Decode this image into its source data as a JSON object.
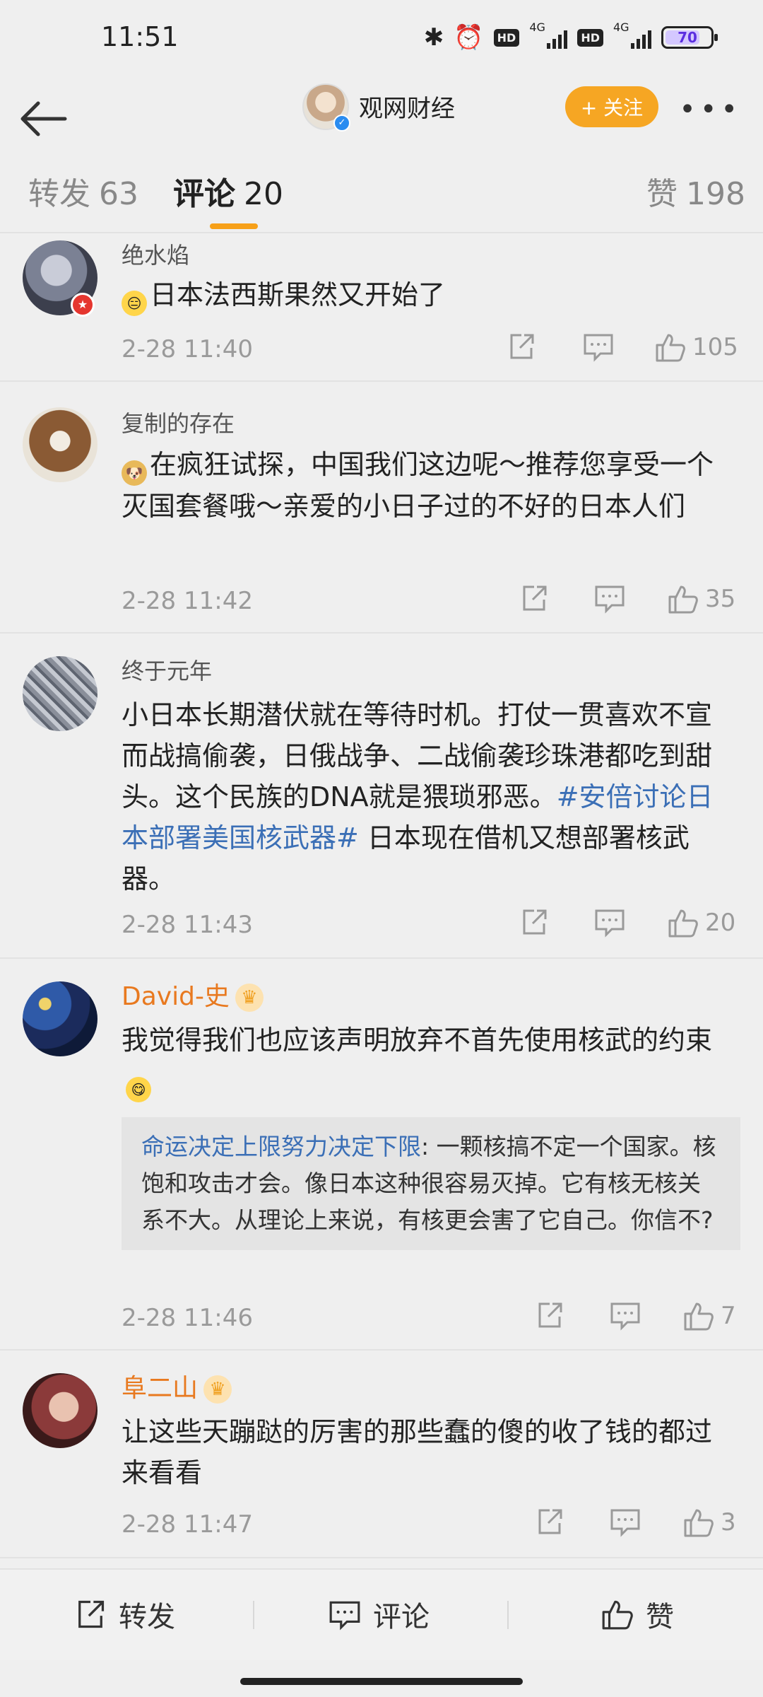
{
  "status_bar": {
    "time": "11:51",
    "network1": "4G",
    "network2": "4G",
    "hd": "HD",
    "battery": "70"
  },
  "nav": {
    "title": "观网财经",
    "follow_label": "+ 关注",
    "avatar_icon": "profile-avatar",
    "more_icon": "more-dots-icon"
  },
  "tabs": [
    {
      "label": "转发",
      "count": "63"
    },
    {
      "label": "评论",
      "count": "20"
    },
    {
      "label": "赞",
      "count": "198"
    }
  ],
  "comments": [
    {
      "user": "绝水焰",
      "text": "日本法西斯果然又开始了",
      "date": "2-28 11:40",
      "likes": "105"
    },
    {
      "user": "复制的存在",
      "text": "在疯狂试探，中国我们这边呢～推荐您享受一个灭国套餐哦～亲爱的小日子过的不好的日本人们",
      "date": "2-28 11:42",
      "likes": "35"
    },
    {
      "user": "终于元年",
      "text_before": "小日本长期潜伏就在等待时机。打仗一贯喜欢不宣而战搞偷袭，日俄战争、二战偷袭珍珠港都吃到甜头。这个民族的DNA就是猥琐邪恶。",
      "hashtag": "#安倍讨论日本部署美国核武器#",
      "text_after": " 日本现在借机又想部署核武器。",
      "date": "2-28 11:43",
      "likes": "20"
    },
    {
      "user": "David-史",
      "text": "我觉得我们也应该声明放弃不首先使用核武的约束",
      "reply_name": "命运决定上限努力决定下限",
      "reply_text": ": 一颗核搞不定一个国家。核饱和攻击才会。像日本这种很容易灭掉。它有核无核关系不大。从理论上来说，有核更会害了它自己。你信不?",
      "date": "2-28 11:46",
      "likes": "7"
    },
    {
      "user": "阜二山",
      "text": "让这些天蹦跶的厉害的那些蠢的傻的收了钱的都过来看看",
      "date": "2-28 11:47",
      "likes": "3"
    }
  ],
  "bottom_bar": {
    "repost": "转发",
    "comment": "评论",
    "like": "赞"
  },
  "colors": {
    "accent": "#f7a018",
    "follow": "#f6a623",
    "link": "#3b6fb6",
    "vip_name": "#e8791f"
  }
}
